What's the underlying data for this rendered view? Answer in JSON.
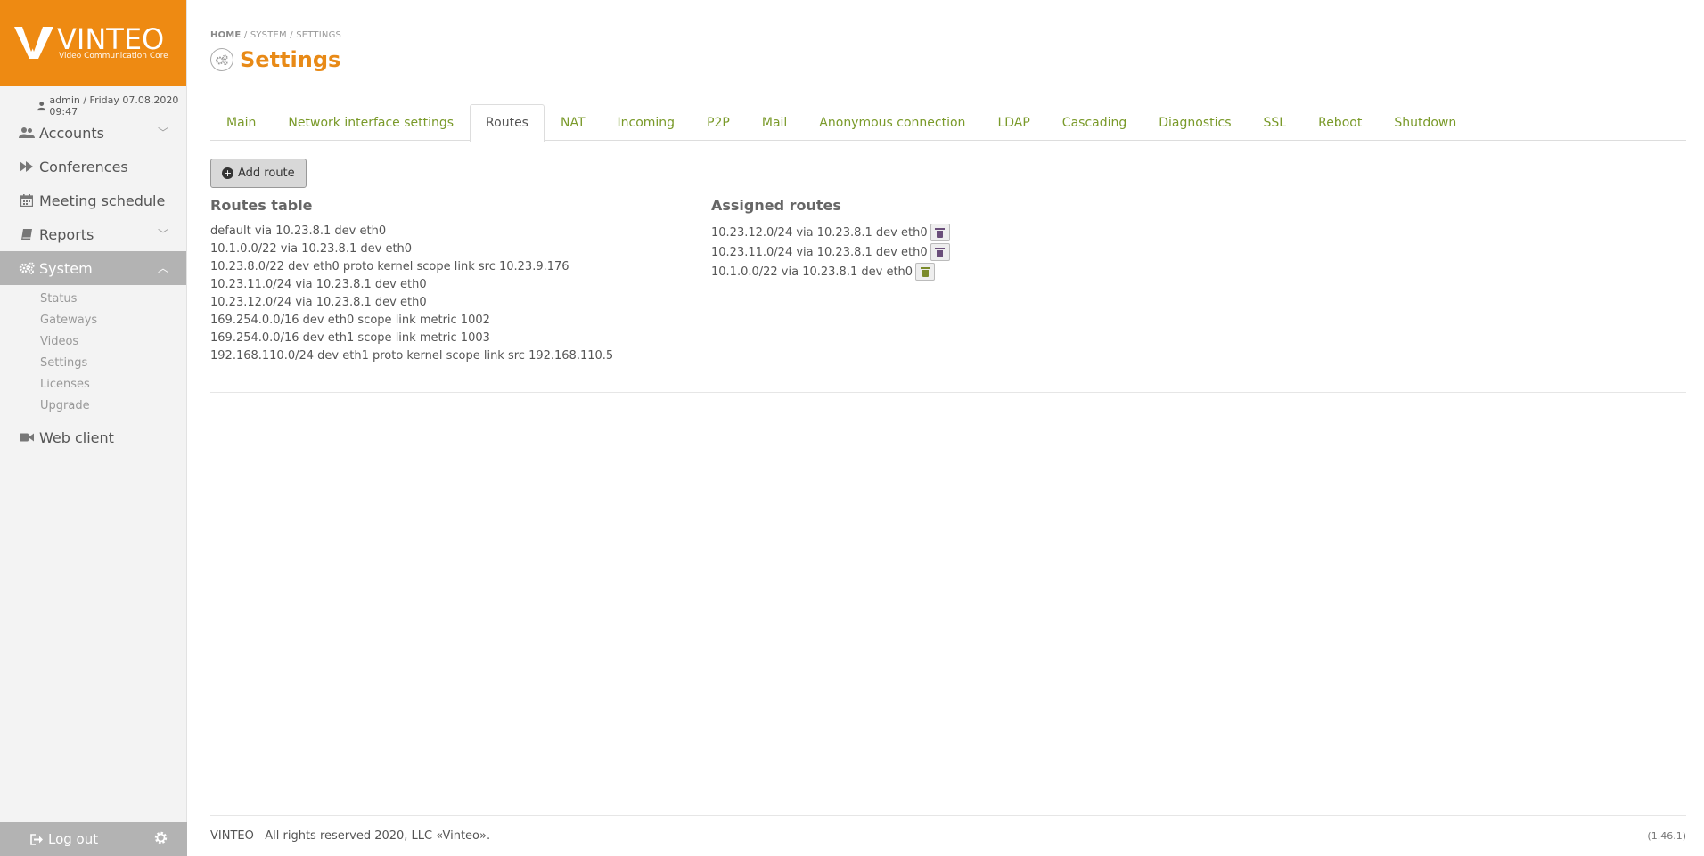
{
  "brand": {
    "name": "VINTEO",
    "tagline": "Video Communication Core",
    "color": "#ee8a12"
  },
  "user": {
    "text": "admin / Friday 07.08.2020 09:47"
  },
  "sidebar": {
    "items": [
      {
        "label": "Accounts",
        "icon": "users-icon"
      },
      {
        "label": "Conferences",
        "icon": "forward-icon"
      },
      {
        "label": "Meeting schedule",
        "icon": "calendar-icon"
      },
      {
        "label": "Reports",
        "icon": "book-icon"
      },
      {
        "label": "System",
        "icon": "cogs-icon"
      },
      {
        "label": "Web client",
        "icon": "video-camera-icon"
      }
    ],
    "system_sub": [
      "Status",
      "Gateways",
      "Videos",
      "Settings",
      "Licenses",
      "Upgrade"
    ],
    "logout": "Log out"
  },
  "breadcrumb": {
    "home": "HOME",
    "system": "SYSTEM",
    "settings": "SETTINGS",
    "sep": "/"
  },
  "page": {
    "title": "Settings"
  },
  "tabs": [
    "Main",
    "Network interface settings",
    "Routes",
    "NAT",
    "Incoming",
    "P2P",
    "Mail",
    "Anonymous connection",
    "LDAP",
    "Cascading",
    "Diagnostics",
    "SSL",
    "Reboot",
    "Shutdown"
  ],
  "active_tab": "Routes",
  "actions": {
    "add_route": "Add route"
  },
  "routes_table": {
    "title": "Routes table",
    "rows": [
      "default via 10.23.8.1 dev eth0",
      "10.1.0.0/22 via 10.23.8.1 dev eth0",
      "10.23.8.0/22 dev eth0 proto kernel scope link src 10.23.9.176",
      "10.23.11.0/24 via 10.23.8.1 dev eth0",
      "10.23.12.0/24 via 10.23.8.1 dev eth0",
      "169.254.0.0/16 dev eth0 scope link metric 1002",
      "169.254.0.0/16 dev eth1 scope link metric 1003",
      "192.168.110.0/24 dev eth1 proto kernel scope link src 192.168.110.5"
    ]
  },
  "assigned_routes": {
    "title": "Assigned routes",
    "rows": [
      {
        "route": "10.23.12.0/24 via 10.23.8.1 dev eth0",
        "icon_color": "#6a4e7a"
      },
      {
        "route": "10.23.11.0/24 via 10.23.8.1 dev eth0",
        "icon_color": "#6a4e7a"
      },
      {
        "route": "10.1.0.0/22 via 10.23.8.1 dev eth0",
        "icon_color": "#7a8a2a"
      }
    ]
  },
  "footer": {
    "brand": "VINTEO",
    "copyright": "All rights reserved 2020, LLC «Vinteo».",
    "version": "(1.46.1)"
  },
  "colors": {
    "accent": "#e88a17",
    "tab_link": "#7a9a2a",
    "sidebar_active": "#b3b3b3"
  }
}
